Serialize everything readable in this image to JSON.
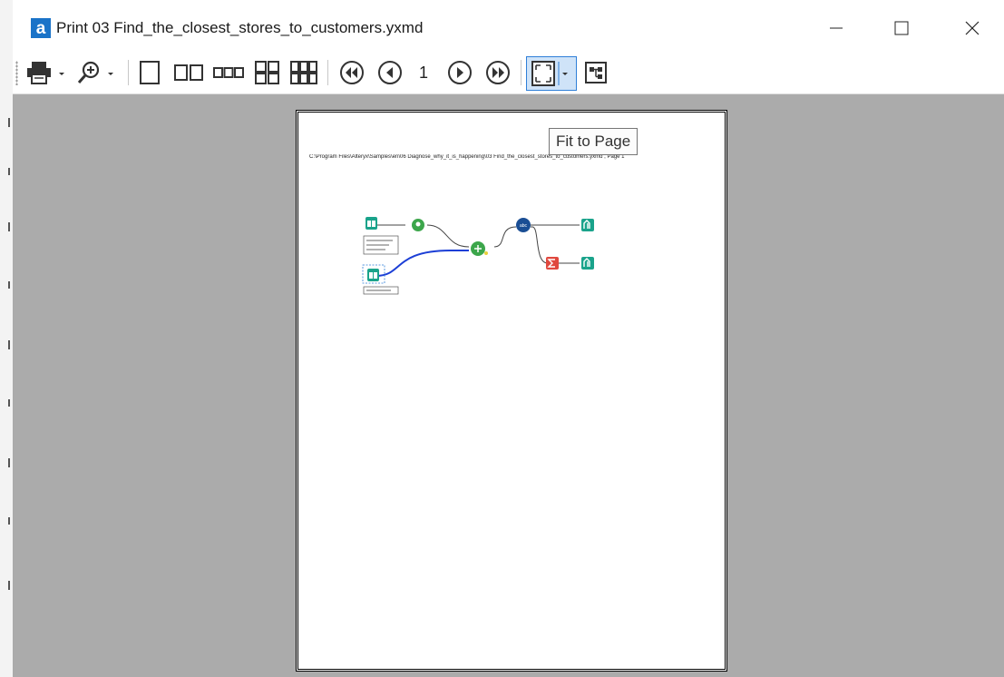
{
  "window": {
    "app_icon_letter": "a",
    "title": "Print 03 Find_the_closest_stores_to_customers.yxmd",
    "controls": {
      "minimize": "minimize",
      "maximize": "maximize",
      "close": "close"
    }
  },
  "toolbar": {
    "icons": [
      "printer-icon",
      "zoom-icon",
      "one-page-icon",
      "two-pages-icon",
      "three-pages-icon",
      "four-pages-icon",
      "six-pages-icon",
      "first-page-icon",
      "previous-page-icon",
      "next-page-icon",
      "last-page-icon",
      "fit-to-page-icon",
      "workflow-layout-icon"
    ],
    "current_page": "1",
    "active_button": "fit-to-page"
  },
  "preview": {
    "header_text": "C:\\Program Files\\Alteryx\\Samples\\en\\06 Diagnose_why_it_is_happening\\03 Find_the_closest_stores_to_customers.yxmd , Page 1",
    "tooltip": "Fit to Page",
    "colors": {
      "background": "#ababab",
      "accent": "#2f7fd8",
      "input_tool": "#1aa38b",
      "spatial_tool": "#3ca64b",
      "append_tool": "#1a4e94",
      "summarize_tool": "#e0483e",
      "selected_connection": "#1c3fd6"
    }
  }
}
